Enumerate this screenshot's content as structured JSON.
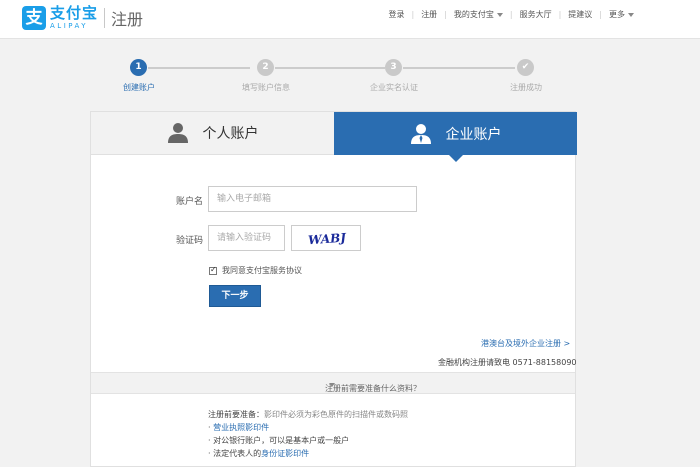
{
  "header": {
    "logo_cn": "支付宝",
    "logo_en": "ALIPAY",
    "page_title": "注册",
    "nav": [
      {
        "label": "登录"
      },
      {
        "label": "注册"
      },
      {
        "label": "我的支付宝"
      },
      {
        "label": "服务大厅"
      },
      {
        "label": "提建议"
      },
      {
        "label": "更多"
      }
    ]
  },
  "steps": [
    {
      "number": "1",
      "label": "创建账户",
      "active": true
    },
    {
      "number": "2",
      "label": "填写账户信息",
      "active": false
    },
    {
      "number": "3",
      "label": "企业实名认证",
      "active": false
    },
    {
      "number": "✔",
      "label": "注册成功",
      "active": false
    }
  ],
  "tabs": {
    "personal": "个人账户",
    "enterprise": "企业账户"
  },
  "form": {
    "account_label": "账户名",
    "account_placeholder": "输入电子邮箱",
    "captcha_label": "验证码",
    "captcha_placeholder": "请输入验证码",
    "captcha_text": "WABJ",
    "agree_text": "我同意支付宝服务协议",
    "agree_checked": true,
    "next_button": "下一步"
  },
  "links": {
    "foreign_register": "港澳台及境外企业注册 >",
    "phone_text": "金融机构注册请致电 0571-88158090"
  },
  "prep": {
    "toggle": "注册前需要准备什么资料？",
    "heading": "注册前要准备：",
    "heading_note": "影印件必须为彩色原件的扫描件或数码照",
    "item1": "营业执照影印件",
    "item2": "· 对公银行账户，可以是基本户或一般户",
    "item3_prefix": "· 法定代表人的",
    "item3_link": "身份证影印件"
  },
  "colors": {
    "brand_blue": "#1a9ee8",
    "accent_blue": "#2a6db1"
  }
}
